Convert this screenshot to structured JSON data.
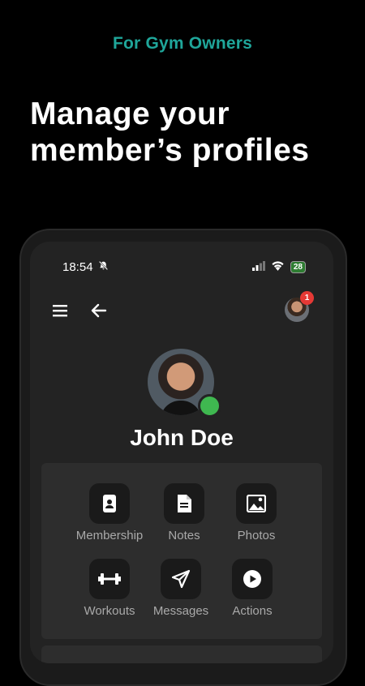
{
  "tagline": "For Gym Owners",
  "headline": [
    "Manage your",
    "member’s profiles"
  ],
  "status_bar": {
    "time": "18:54",
    "battery": "28"
  },
  "header": {
    "notification_count": "1"
  },
  "profile": {
    "name": "John Doe",
    "online": true
  },
  "actions": [
    {
      "label": "Membership",
      "icon": "membership-card-icon"
    },
    {
      "label": "Notes",
      "icon": "document-icon"
    },
    {
      "label": "Photos",
      "icon": "image-icon"
    },
    {
      "label": "Workouts",
      "icon": "dumbbell-icon"
    },
    {
      "label": "Messages",
      "icon": "send-icon"
    },
    {
      "label": "Actions",
      "icon": "play-circle-icon"
    }
  ],
  "colors": {
    "accent": "#1fa69a",
    "online": "#3fb850",
    "badge": "#e53935"
  }
}
